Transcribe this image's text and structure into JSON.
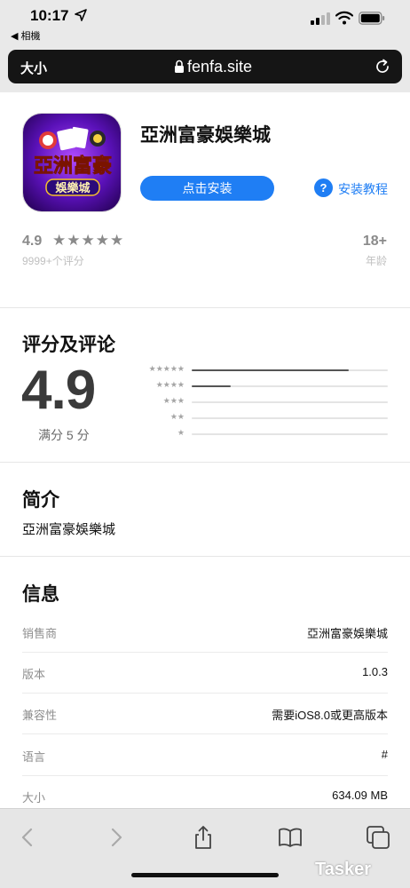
{
  "status_bar": {
    "time": "10:17",
    "back_app": "◀ 相機"
  },
  "browser": {
    "text_size_label": "大小",
    "domain": "fenfa.site"
  },
  "app": {
    "name": "亞洲富豪娛樂城",
    "icon_text_top": "亞洲富豪",
    "icon_text_bottom": "娛樂城",
    "install_label": "点击安装",
    "help_label": "安装教程",
    "help_icon_glyph": "?",
    "rating": "4.9",
    "stars": "★★★★★",
    "rating_count": "9999+个评分",
    "age": "18+",
    "age_label": "年龄"
  },
  "ratings": {
    "title": "评分及评论",
    "score": "4.9",
    "out_of": "满分 5 分",
    "distribution": [
      {
        "stars": "★★★★★",
        "fraction": 0.8
      },
      {
        "stars": "★★★★",
        "fraction": 0.2
      },
      {
        "stars": "★★★",
        "fraction": 0.0
      },
      {
        "stars": "★★",
        "fraction": 0.0
      },
      {
        "stars": "★",
        "fraction": 0.0
      }
    ]
  },
  "intro": {
    "title": "简介",
    "text": "亞洲富豪娛樂城"
  },
  "info": {
    "title": "信息",
    "rows": [
      {
        "label": "销售商",
        "value": "亞洲富豪娛樂城"
      },
      {
        "label": "版本",
        "value": "1.0.3"
      },
      {
        "label": "兼容性",
        "value": "需要iOS8.0或更高版本"
      },
      {
        "label": "语言",
        "value": "#"
      },
      {
        "label": "大小",
        "value": "634.09 MB"
      }
    ]
  },
  "watermark": "Tasker",
  "colors": {
    "accent": "#1f7ef4",
    "chrome": "#e9e9e9",
    "url_bar": "#151515"
  }
}
